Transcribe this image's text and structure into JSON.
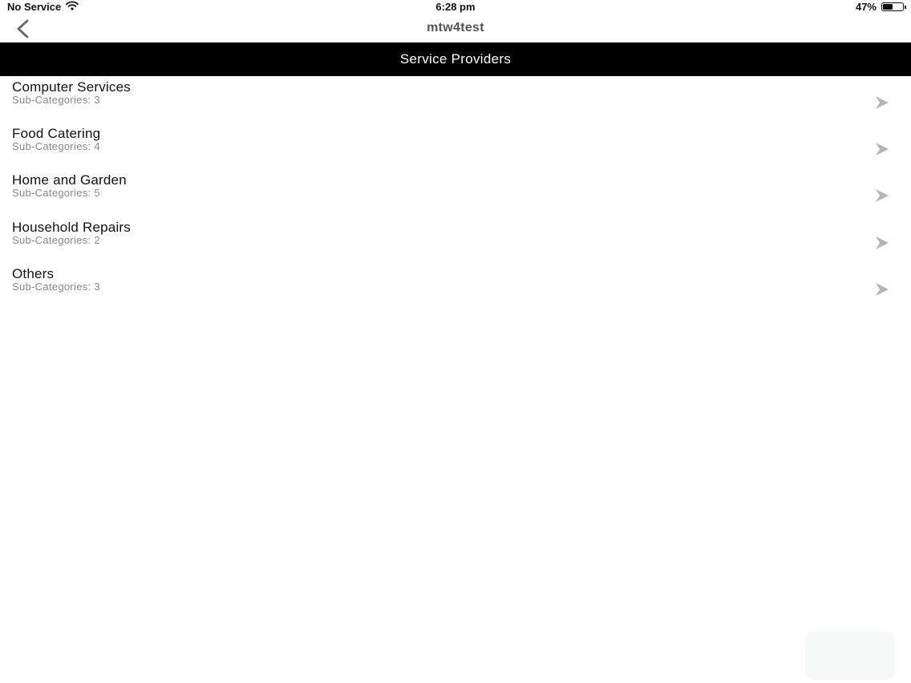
{
  "status_bar": {
    "carrier": "No Service",
    "time": "6:28 pm",
    "battery_percent": "47%",
    "battery_level": 0.47,
    "wifi_icon": "wifi-icon",
    "battery_icon": "battery-icon"
  },
  "nav": {
    "title": "mtw4test",
    "back_icon": "chevron-left-icon"
  },
  "header": {
    "title": "Service Providers"
  },
  "categories": [
    {
      "title": "Computer Services",
      "subtitle": "Sub-Categories: 3"
    },
    {
      "title": "Food Catering",
      "subtitle": "Sub-Categories: 4"
    },
    {
      "title": "Home and Garden",
      "subtitle": "Sub-Categories: 5"
    },
    {
      "title": "Household Repairs",
      "subtitle": "Sub-Categories: 2"
    },
    {
      "title": "Others",
      "subtitle": "Sub-Categories: 3"
    }
  ],
  "colors": {
    "header_bg": "#000000",
    "chevron": "#b5b5b5",
    "subtitle": "#888888"
  }
}
